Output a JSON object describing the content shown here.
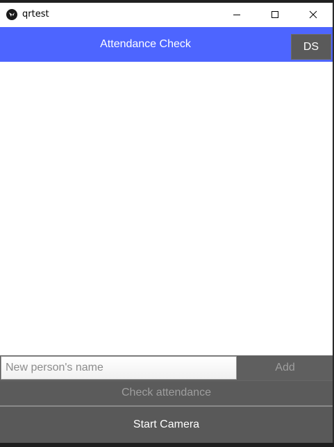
{
  "window": {
    "title": "qrtest",
    "icon": "app-icon"
  },
  "header": {
    "title": "Attendance Check",
    "ds_label": "DS",
    "color": "#4d65ff"
  },
  "form": {
    "name_placeholder": "New person's name",
    "add_label": "Add",
    "check_label": "Check attendance",
    "camera_label": "Start Camera"
  }
}
